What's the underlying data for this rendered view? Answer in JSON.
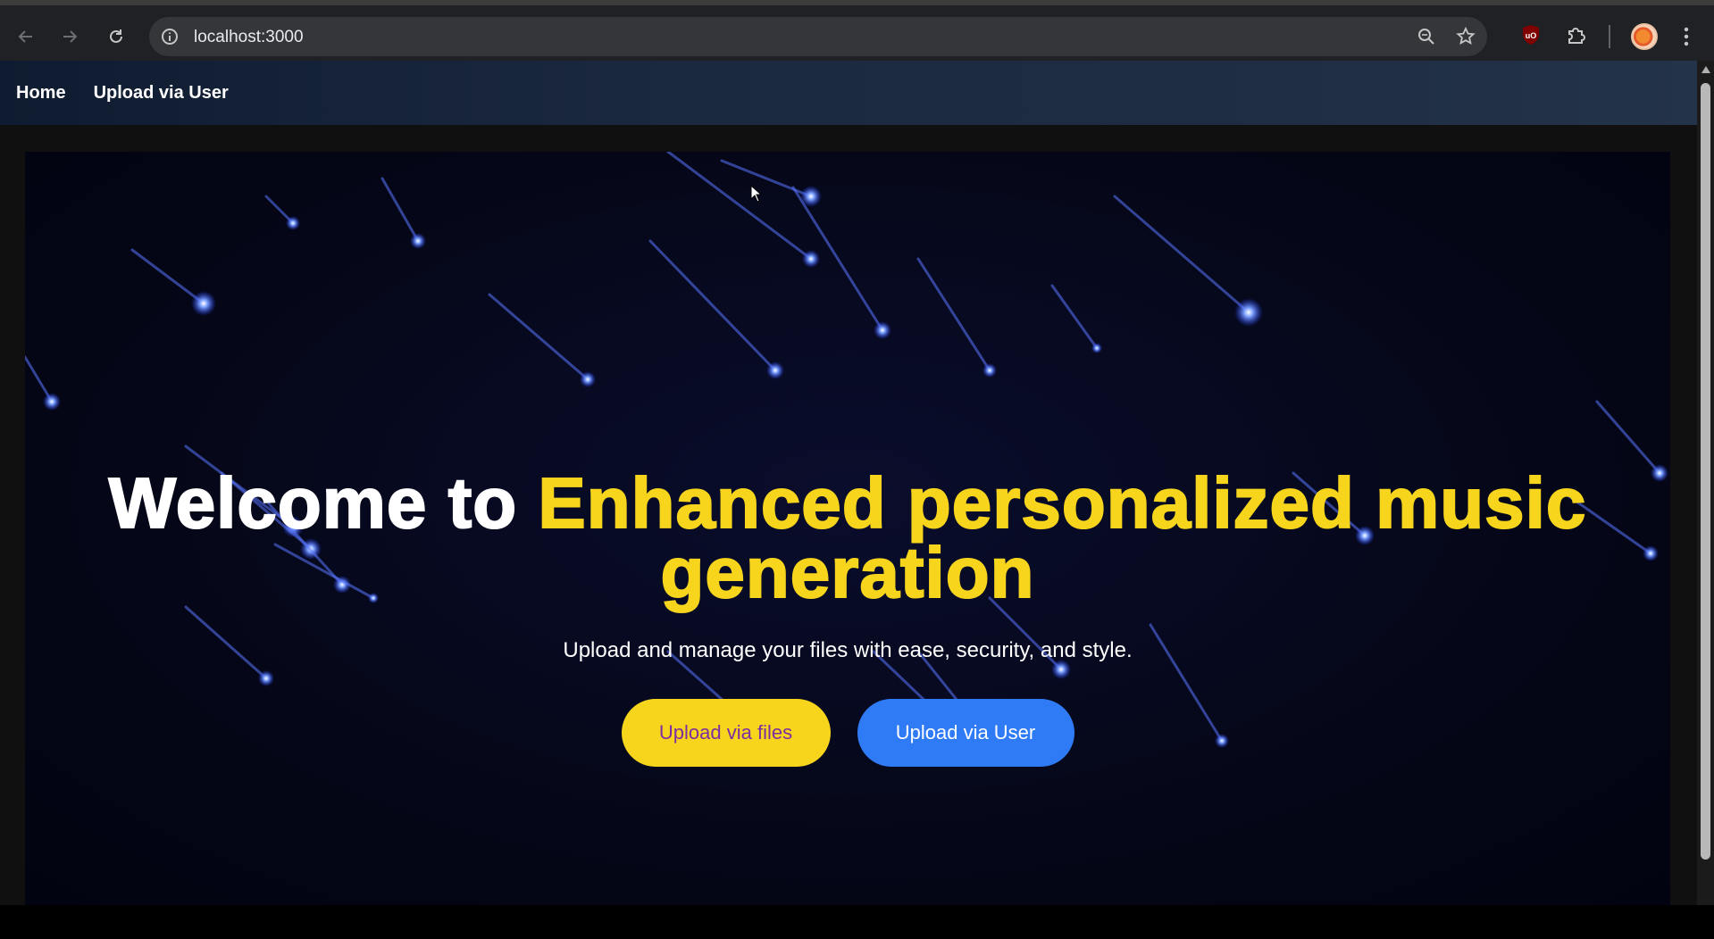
{
  "browser": {
    "url": "localhost:3000",
    "icons": [
      "back-icon",
      "forward-icon",
      "reload-icon",
      "site-info-icon",
      "zoom-icon",
      "bookmark-star-icon",
      "ublock-extension-icon",
      "extensions-puzzle-icon",
      "profile-avatar",
      "browser-menu-icon"
    ],
    "extension_badge": "uO"
  },
  "site_nav": {
    "items": [
      {
        "label": "Home"
      },
      {
        "label": "Upload via User"
      }
    ]
  },
  "hero": {
    "title_plain": "Welcome to ",
    "title_highlight": "Enhanced personalized music generation",
    "subtitle": "Upload and manage your files with ease, security, and style.",
    "buttons": [
      {
        "label": "Upload via files",
        "color": "#f7d51d",
        "text_color": "#7b2fa0"
      },
      {
        "label": "Upload via User",
        "color": "#2f7bf5",
        "text_color": "#ffffff"
      }
    ],
    "highlight_color": "#f7d51d",
    "background": "starry sky with blue shooting meteors"
  }
}
